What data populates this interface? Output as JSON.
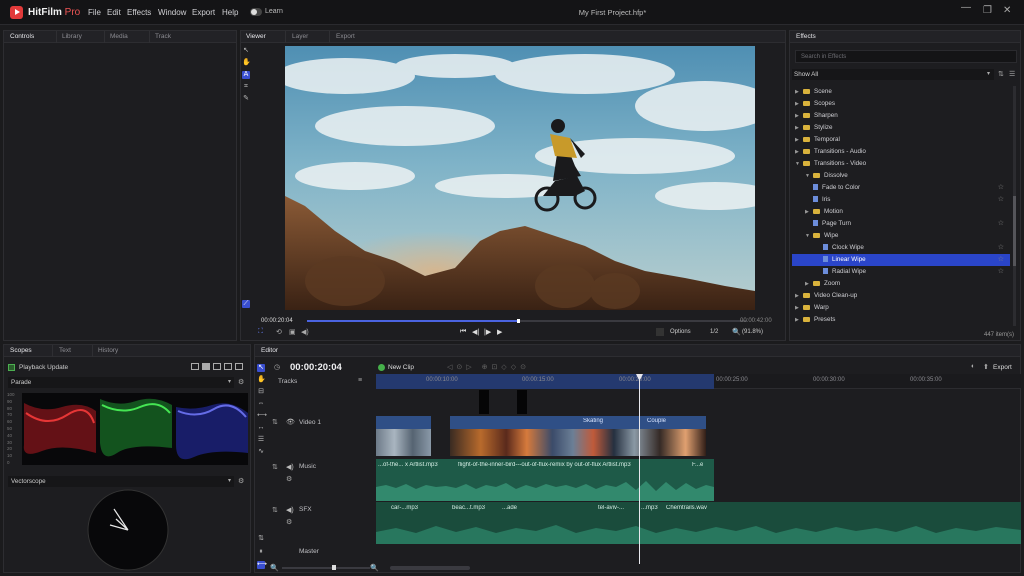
{
  "app": {
    "name": "HitFilm",
    "edition": "Pro",
    "document_title": "My First Project.hfp*",
    "learn_label": "Learn",
    "menu": [
      "File",
      "Edit",
      "Effects",
      "Window",
      "Export",
      "Help"
    ]
  },
  "left_panel": {
    "tabs": [
      "Controls",
      "Library",
      "Media",
      "Track"
    ]
  },
  "viewer": {
    "tabs": [
      "Viewer",
      "Layer",
      "Export"
    ],
    "current_time": "00:00:20:04",
    "end_time": "00:00:42:00",
    "options_label": "Options",
    "resolution": "1/2",
    "zoom": "(91.8%)",
    "progress": 0.48
  },
  "effects": {
    "tab": "Effects",
    "search_placeholder": "Search in Effects",
    "filter": "Show All",
    "item_count": "447 item(s)",
    "items": [
      {
        "label": "Scene",
        "kind": "folder",
        "depth": 0,
        "expanded": false
      },
      {
        "label": "Scopes",
        "kind": "folder",
        "depth": 0,
        "expanded": false
      },
      {
        "label": "Sharpen",
        "kind": "folder",
        "depth": 0,
        "expanded": false
      },
      {
        "label": "Stylize",
        "kind": "folder",
        "depth": 0,
        "expanded": false
      },
      {
        "label": "Temporal",
        "kind": "folder",
        "depth": 0,
        "expanded": false
      },
      {
        "label": "Transitions - Audio",
        "kind": "folder",
        "depth": 0,
        "expanded": false
      },
      {
        "label": "Transitions - Video",
        "kind": "folder",
        "depth": 0,
        "expanded": true
      },
      {
        "label": "Dissolve",
        "kind": "folder",
        "depth": 1,
        "expanded": true
      },
      {
        "label": "Fade to Color",
        "kind": "file",
        "depth": 1,
        "star": true
      },
      {
        "label": "Iris",
        "kind": "file",
        "depth": 1,
        "star": true
      },
      {
        "label": "Motion",
        "kind": "folder",
        "depth": 1,
        "expanded": false
      },
      {
        "label": "Page Turn",
        "kind": "file",
        "depth": 1,
        "star": true
      },
      {
        "label": "Wipe",
        "kind": "folder",
        "depth": 1,
        "expanded": true
      },
      {
        "label": "Clock Wipe",
        "kind": "file",
        "depth": 2,
        "star": true
      },
      {
        "label": "Linear Wipe",
        "kind": "file",
        "depth": 2,
        "star": true,
        "selected": true
      },
      {
        "label": "Radial Wipe",
        "kind": "file",
        "depth": 2,
        "star": true
      },
      {
        "label": "Zoom",
        "kind": "folder",
        "depth": 1,
        "expanded": false
      },
      {
        "label": "Video Clean-up",
        "kind": "folder",
        "depth": 0,
        "expanded": false
      },
      {
        "label": "Warp",
        "kind": "folder",
        "depth": 0,
        "expanded": false
      },
      {
        "label": "Presets",
        "kind": "folder",
        "depth": 0,
        "expanded": false
      }
    ]
  },
  "scopes": {
    "tabs": [
      "Scopes",
      "Text",
      "History"
    ],
    "playback_update": "Playback Update",
    "parade_label": "Parade",
    "vectorscope_label": "Vectorscope",
    "axis": [
      "100",
      "90",
      "80",
      "70",
      "60",
      "50",
      "40",
      "30",
      "20",
      "10",
      "0"
    ]
  },
  "editor": {
    "tab": "Editor",
    "timecode": "00:00:20:04",
    "new_clip": "New Clip",
    "export": "Export",
    "tracks_label": "Tracks",
    "ruler": [
      "00:00:10:00",
      "00:00:15:00",
      "00:00:20:00",
      "00:00:25:00",
      "00:00:30:00",
      "00:00:35:00"
    ],
    "tracks": {
      "video1": "Video 1",
      "music": "Music",
      "sfx": "SFX",
      "master": "Master"
    },
    "video_clips": [
      "Skating",
      "Couple"
    ],
    "music_clips": [
      "...of-the... x Artlist.mp3",
      "flight-of-the-inner-bird---out-of-flux-remix by out-of-flux Artlist.mp3",
      "F...e"
    ],
    "sfx_clips": [
      "car-...mp3",
      "beac...t.mp3",
      "...ade",
      "tel-aviv-...",
      "...mp3",
      "Chemtrails.wav"
    ]
  }
}
